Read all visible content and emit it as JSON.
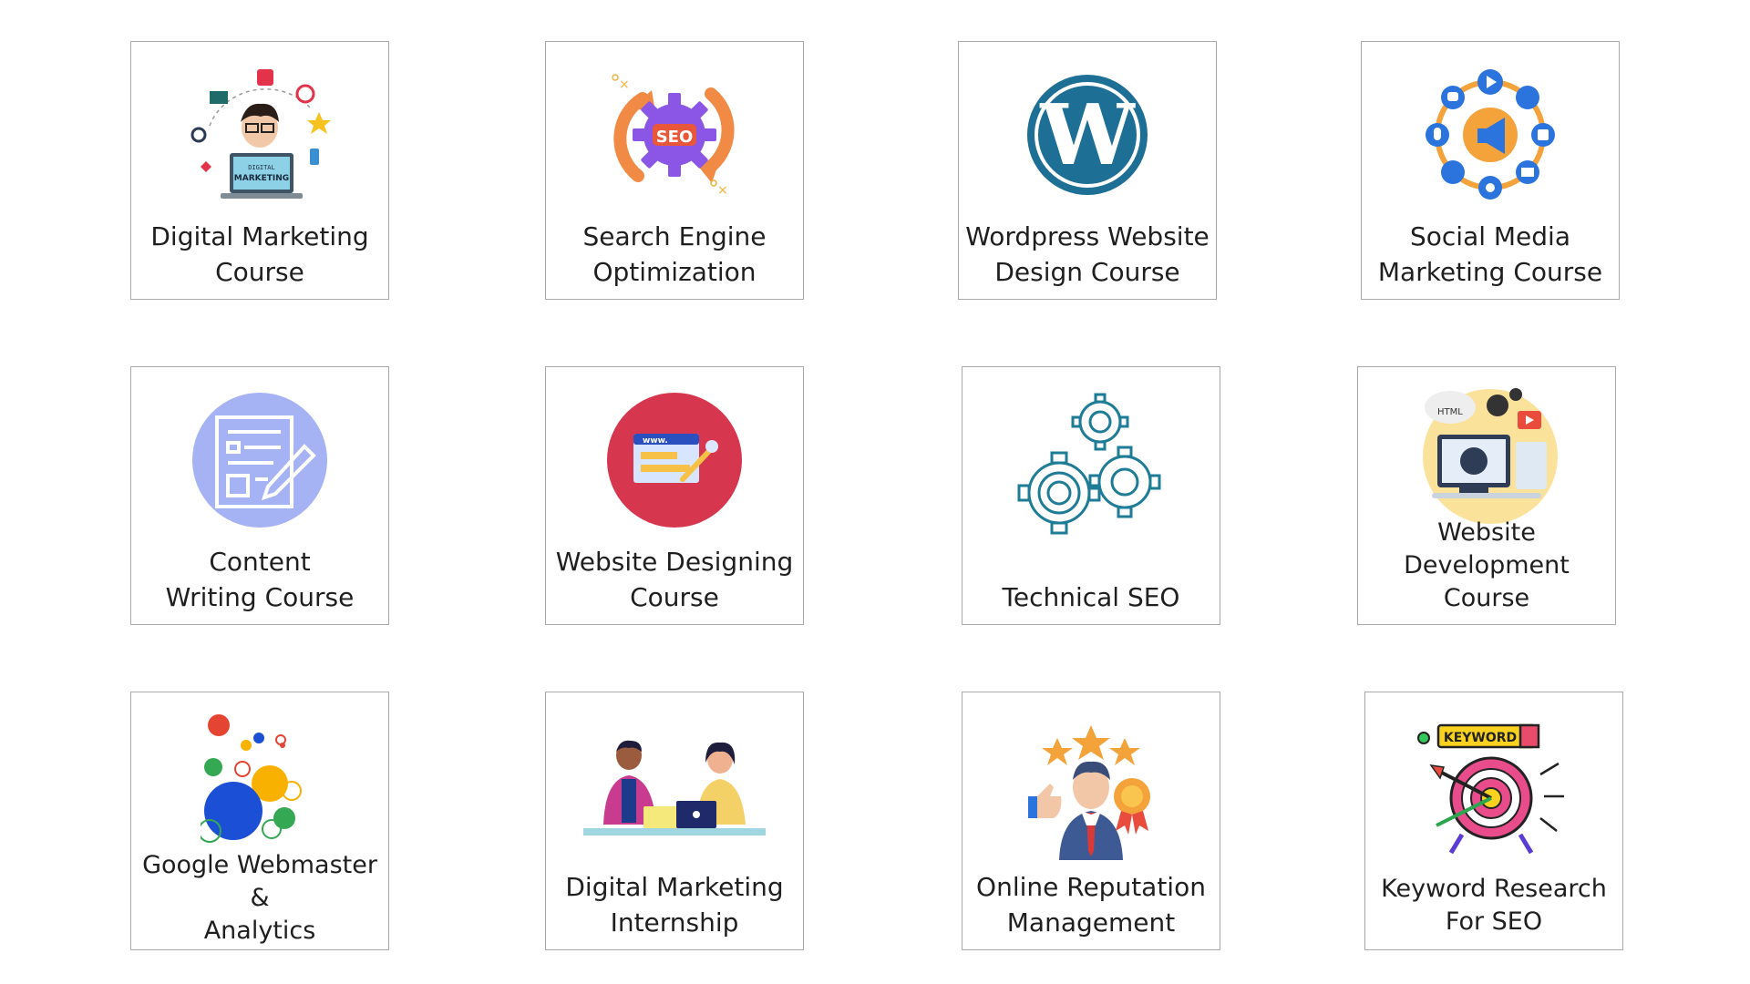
{
  "courses": [
    {
      "line1": "Digital Marketing",
      "line2": "Course",
      "icon": "digital-marketing-icon"
    },
    {
      "line1": "Search Engine",
      "line2": "Optimization",
      "icon": "seo-gear-icon"
    },
    {
      "line1": "Wordpress Website",
      "line2": "Design Course",
      "icon": "wordpress-icon"
    },
    {
      "line1": "Social Media",
      "line2": "Marketing Course",
      "icon": "social-media-icon"
    },
    {
      "line1": "Content",
      "line2": "Writing Course",
      "icon": "content-writing-icon"
    },
    {
      "line1": "Website Designing",
      "line2": "Course",
      "icon": "website-design-icon"
    },
    {
      "line1": "Technical SEO",
      "icon": "gears-icon"
    },
    {
      "line1": "Website",
      "line2": "Development Course",
      "icon": "web-development-icon"
    },
    {
      "line1": "Google Webmaster",
      "line2": "&",
      "line3": "Analytics",
      "icon": "google-analytics-icon"
    },
    {
      "line1": "Digital Marketing",
      "line2": "Internship",
      "icon": "internship-icon"
    },
    {
      "line1": "Online Reputation",
      "line2": "Management",
      "icon": "reputation-icon"
    },
    {
      "line1": "Keyword Research",
      "line2": "For SEO",
      "icon": "keyword-target-icon"
    }
  ],
  "icon_text": {
    "laptop_l1": "DIGITAL",
    "laptop_l2": "MARKETING",
    "seo": "SEO",
    "www": "www.",
    "html": "HTML",
    "keyword": "KEYWORD"
  },
  "colors": {
    "wordpress": "#1e6f95",
    "teal": "#1e7c96",
    "lavender": "#a5b2f3",
    "crimson": "#d6364e",
    "orange": "#f4a23a",
    "blue": "#2b74de",
    "google_red": "#e64433",
    "google_yellow": "#f9b100",
    "google_green": "#34a853",
    "google_blue": "#1a4fd6"
  }
}
